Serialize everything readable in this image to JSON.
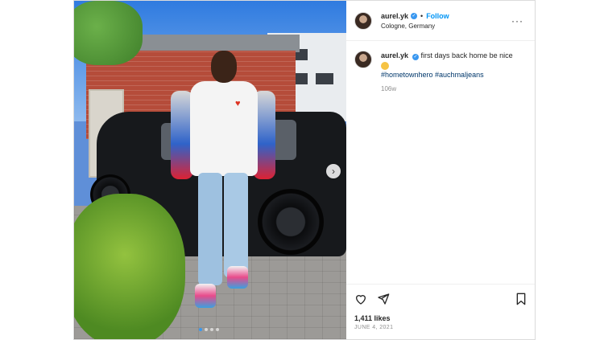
{
  "post": {
    "username": "aurel.yk",
    "verified_icon": "verified-badge-icon",
    "separator": "•",
    "follow_label": "Follow",
    "location": "Cologne, Germany",
    "more_label": "···",
    "caption_text": "first days back home be nice",
    "caption_hashtags": "#hometownhero #auchmaljeans",
    "time_ago": "106w",
    "likes": "1,411 likes",
    "date": "JUNE 4, 2021",
    "media": {
      "slide_count": 4,
      "active_slide": 1,
      "next_label": "›"
    }
  },
  "icons": {
    "like": "heart-icon",
    "share": "send-icon",
    "save": "bookmark-icon"
  },
  "colors": {
    "accent": "#0095f6",
    "verified": "#3897f0",
    "text": "#262626",
    "muted": "#8e8e8e",
    "hashtag": "#00376b"
  }
}
